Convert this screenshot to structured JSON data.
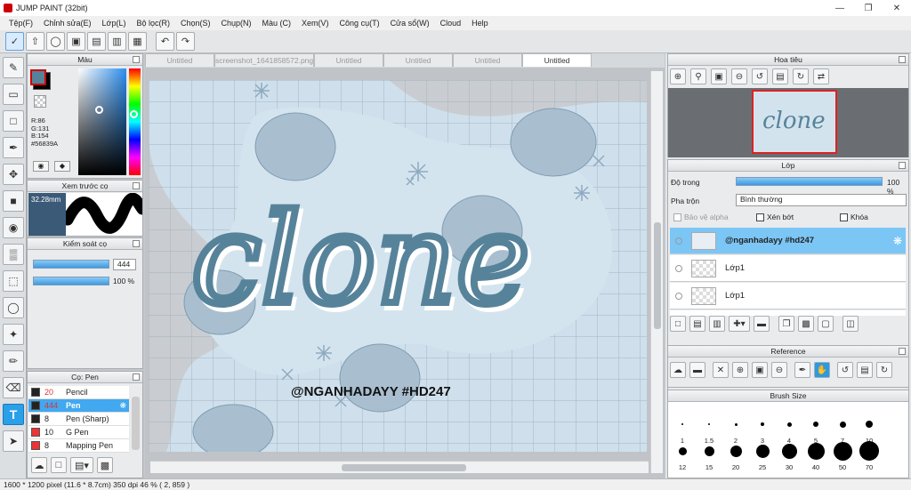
{
  "window": {
    "title": "JUMP PAINT (32bit)"
  },
  "menu": [
    "Tệp(F)",
    "Chỉnh sửa(E)",
    "Lớp(L)",
    "Bộ lọc(R)",
    "Chọn(S)",
    "Chụp(N)",
    "Màu (C)",
    "Xem(V)",
    "Công cụ(T)",
    "Cửa sổ(W)",
    "Cloud",
    "Help"
  ],
  "tabs": [
    "Untitled",
    "screenshot_1641858572.png",
    "Untitled",
    "Untitled",
    "Untitled",
    "Untitled"
  ],
  "color_panel": {
    "title": "Màu",
    "r": "R:86",
    "g": "G:131",
    "b": "B:154",
    "hex": "#56839A",
    "foreground": "#56839A"
  },
  "preview_panel": {
    "title": "Xem trước cọ",
    "size": "32.28mm"
  },
  "control_panel": {
    "title": "Kiểm soát cọ",
    "size_value": "444",
    "opacity_value": "100 %",
    "size_level": 0.95,
    "opacity_level": 1.0
  },
  "brush_panel": {
    "title": "Cọ: Pen",
    "brushes": [
      {
        "size": "20",
        "name": "Pencil"
      },
      {
        "size": "444",
        "name": "Pen"
      },
      {
        "size": "8",
        "name": "Pen (Sharp)"
      },
      {
        "size": "10",
        "name": "G Pen"
      },
      {
        "size": "8",
        "name": "Mapping Pen"
      }
    ]
  },
  "canvas": {
    "text_main": "clone",
    "text_sub": "@NGANHADAYY #HD247"
  },
  "navigator": {
    "title": "Hoa tiêu",
    "thumb_text": "clone"
  },
  "layer_panel": {
    "title": "Lớp",
    "opacity_label": "Độ trong",
    "opacity_value": "100 %",
    "opacity_level": 1.0,
    "blend_label": "Pha trộn",
    "blend_value": "Bình thường",
    "protect_alpha": "Bảo vệ alpha",
    "clipping": "Xén bớt",
    "lock": "Khóa",
    "layers": [
      {
        "name": "@nganhadayy #hd247"
      },
      {
        "name": "Lớp1"
      },
      {
        "name": "Lớp1"
      }
    ]
  },
  "reference_panel": {
    "title": "Reference"
  },
  "brushsize_panel": {
    "title": "Brush Size",
    "row1": [
      "1",
      "1.5",
      "2",
      "3",
      "4",
      "5",
      "7",
      "10"
    ],
    "row2": [
      "12",
      "15",
      "20",
      "25",
      "30",
      "40",
      "50",
      "70"
    ]
  },
  "status": {
    "text": "1600 * 1200 pixel   (11.6 * 8.7cm)   350 dpi   46 %   ( 2, 859 )"
  }
}
